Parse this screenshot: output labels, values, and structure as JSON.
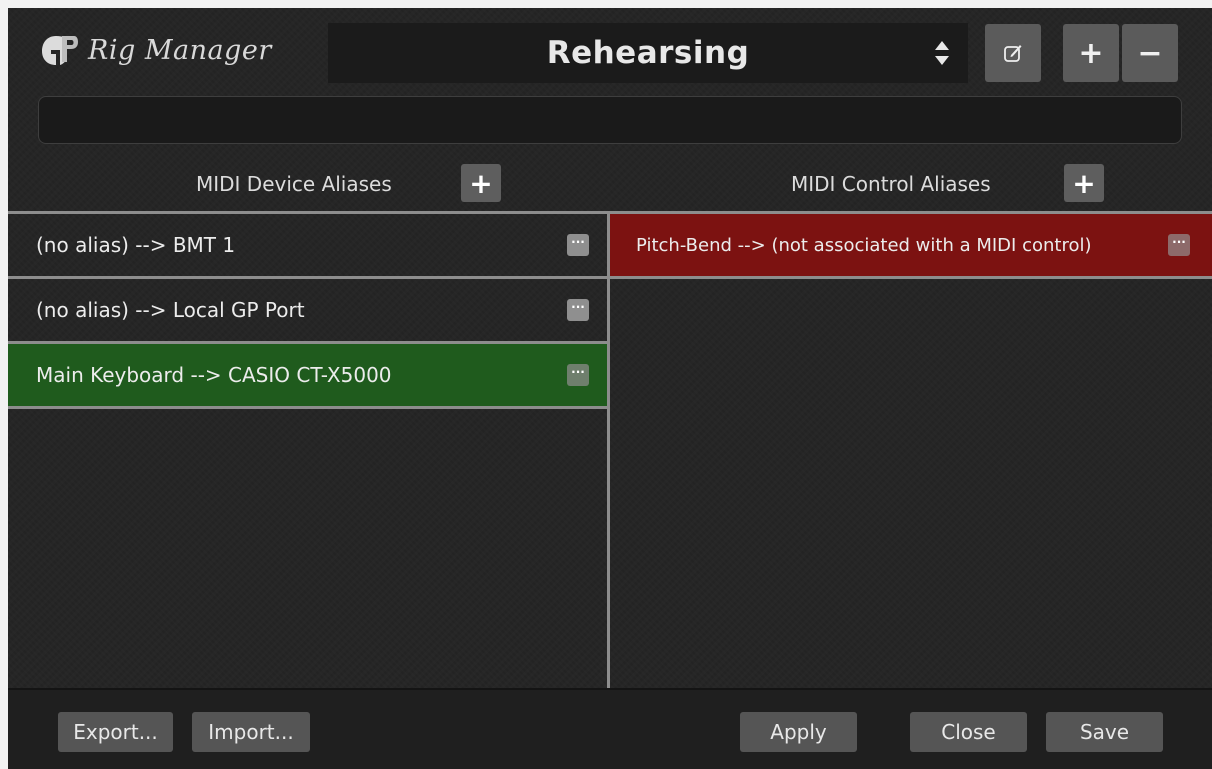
{
  "header": {
    "app_title": "Rig Manager",
    "rig_name": "Rehearsing",
    "edit_icon": "pencil-square-icon",
    "add_label": "+",
    "remove_label": "−"
  },
  "notes": {
    "value": ""
  },
  "device_aliases": {
    "title": "MIDI Device Aliases",
    "add_label": "+",
    "items": [
      {
        "label": "(no alias) --> BMT 1",
        "selected": false
      },
      {
        "label": "(no alias) --> Local GP Port",
        "selected": false
      },
      {
        "label": "Main Keyboard --> CASIO CT-X5000",
        "selected": true,
        "color": "#1f5b1d"
      }
    ]
  },
  "control_aliases": {
    "title": "MIDI Control Aliases",
    "add_label": "+",
    "items": [
      {
        "label": "Pitch-Bend --> (not associated with a MIDI control)",
        "selected": true,
        "color": "#7c1211"
      }
    ]
  },
  "more_label": "···",
  "footer": {
    "export": "Export...",
    "import": "Import...",
    "apply": "Apply",
    "close": "Close",
    "save": "Save"
  }
}
